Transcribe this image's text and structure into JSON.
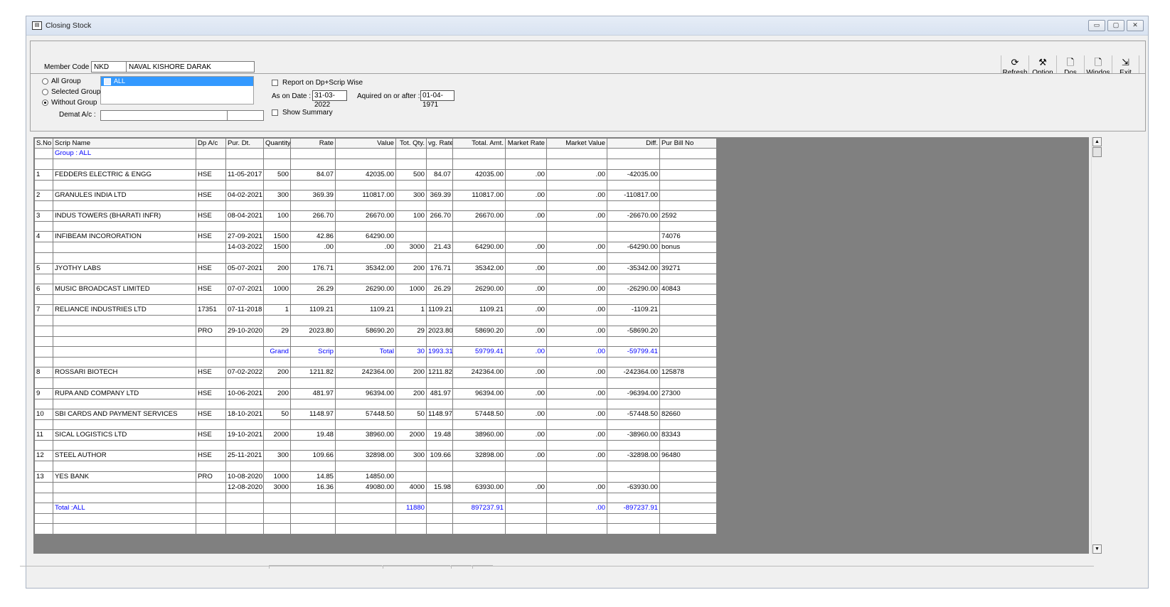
{
  "window": {
    "title": "Closing Stock",
    "icon": "app-icon",
    "buttons": {
      "minimize": "▭",
      "maximize": "▢",
      "close": "✕"
    }
  },
  "member": {
    "label": "Member Code :",
    "code": "NKD",
    "name": "NAVAL KISHORE DARAK"
  },
  "toolbar": [
    {
      "label": "Refresh",
      "icon": "refresh-icon",
      "glyph": "⟳"
    },
    {
      "label": "Option",
      "icon": "tools-icon",
      "glyph": "⚒"
    },
    {
      "label": "Dos",
      "icon": "dos-preview-icon",
      "glyph": "🗋"
    },
    {
      "label": "Windos",
      "icon": "window-preview-icon",
      "glyph": "🗋"
    },
    {
      "label": "Exit",
      "icon": "exit-door-icon",
      "glyph": "⇲"
    }
  ],
  "filters": {
    "radio_all": "All Group",
    "radio_selected": "Selected Group",
    "radio_without": "Without Group",
    "selected_radio": "without",
    "group_list_item": "ALL",
    "demat_label": "Demat A/c :",
    "report_dp_scrip": "Report on Dp+Scrip Wise",
    "as_on_label": "As on Date :",
    "as_on_value": "31-03-2022",
    "acquired_label": "Aquired on or after :",
    "acquired_value": "01-04-1971",
    "show_summary": "Show Summary"
  },
  "grid": {
    "columns": [
      "S.No",
      "Scrip Name",
      "Dp A/c",
      "Pur. Dt.",
      "Quantity",
      "Rate",
      "Value",
      "Tot. Qty.",
      "vg. Rate",
      "Total. Amt.",
      "Market Rate",
      "Market Value",
      "Diff.",
      "Pur Bill No"
    ],
    "rows": [
      {
        "c": [
          "",
          "Group : ALL",
          "",
          "",
          "",
          "",
          "",
          "",
          "",
          "",
          "",
          "",
          "",
          ""
        ],
        "blue": true
      },
      {
        "c": [
          "",
          "",
          "",
          "",
          "",
          "",
          "",
          "",
          "",
          "",
          "",
          "",
          "",
          ""
        ]
      },
      {
        "c": [
          "1",
          "FEDDERS ELECTRIC & ENGG",
          "HSE",
          "11-05-2017",
          "500",
          "84.07",
          "42035.00",
          "500",
          "84.07",
          "42035.00",
          ".00",
          ".00",
          "-42035.00",
          ""
        ]
      },
      {
        "c": [
          "",
          "",
          "",
          "",
          "",
          "",
          "",
          "",
          "",
          "",
          "",
          "",
          "",
          ""
        ]
      },
      {
        "c": [
          "2",
          "GRANULES INDIA LTD",
          "HSE",
          "04-02-2021",
          "300",
          "369.39",
          "110817.00",
          "300",
          "369.39",
          "110817.00",
          ".00",
          ".00",
          "-110817.00",
          ""
        ]
      },
      {
        "c": [
          "",
          "",
          "",
          "",
          "",
          "",
          "",
          "",
          "",
          "",
          "",
          "",
          "",
          ""
        ]
      },
      {
        "c": [
          "3",
          "INDUS TOWERS (BHARATI INFR)",
          "HSE",
          "08-04-2021",
          "100",
          "266.70",
          "26670.00",
          "100",
          "266.70",
          "26670.00",
          ".00",
          ".00",
          "-26670.00",
          "2592"
        ]
      },
      {
        "c": [
          "",
          "",
          "",
          "",
          "",
          "",
          "",
          "",
          "",
          "",
          "",
          "",
          "",
          ""
        ]
      },
      {
        "c": [
          "4",
          "INFIBEAM INCORORATION",
          "HSE",
          "27-09-2021",
          "1500",
          "42.86",
          "64290.00",
          "",
          "",
          "",
          "",
          "",
          "",
          "74076"
        ]
      },
      {
        "c": [
          "",
          "",
          "",
          "14-03-2022",
          "1500",
          ".00",
          ".00",
          "3000",
          "21.43",
          "64290.00",
          ".00",
          ".00",
          "-64290.00",
          "bonus"
        ]
      },
      {
        "c": [
          "",
          "",
          "",
          "",
          "",
          "",
          "",
          "",
          "",
          "",
          "",
          "",
          "",
          ""
        ]
      },
      {
        "c": [
          "5",
          "JYOTHY LABS",
          "HSE",
          "05-07-2021",
          "200",
          "176.71",
          "35342.00",
          "200",
          "176.71",
          "35342.00",
          ".00",
          ".00",
          "-35342.00",
          "39271"
        ]
      },
      {
        "c": [
          "",
          "",
          "",
          "",
          "",
          "",
          "",
          "",
          "",
          "",
          "",
          "",
          "",
          ""
        ]
      },
      {
        "c": [
          "6",
          "MUSIC BROADCAST LIMITED",
          "HSE",
          "07-07-2021",
          "1000",
          "26.29",
          "26290.00",
          "1000",
          "26.29",
          "26290.00",
          ".00",
          ".00",
          "-26290.00",
          "40843"
        ]
      },
      {
        "c": [
          "",
          "",
          "",
          "",
          "",
          "",
          "",
          "",
          "",
          "",
          "",
          "",
          "",
          ""
        ]
      },
      {
        "c": [
          "7",
          "RELIANCE INDUSTRIES LTD",
          "17351",
          "07-11-2018",
          "1",
          "1109.21",
          "1109.21",
          "1",
          "1109.21",
          "1109.21",
          ".00",
          ".00",
          "-1109.21",
          ""
        ]
      },
      {
        "c": [
          "",
          "",
          "",
          "",
          "",
          "",
          "",
          "",
          "",
          "",
          "",
          "",
          "",
          ""
        ]
      },
      {
        "c": [
          "",
          "",
          "PRO",
          "29-10-2020",
          "29",
          "2023.80",
          "58690.20",
          "29",
          "2023.80",
          "58690.20",
          ".00",
          ".00",
          "-58690.20",
          ""
        ]
      },
      {
        "c": [
          "",
          "",
          "",
          "",
          "",
          "",
          "",
          "",
          "",
          "",
          "",
          "",
          "",
          ""
        ]
      },
      {
        "c": [
          "",
          "",
          "",
          "",
          "Grand",
          "Scrip",
          "Total",
          "30",
          "1993.31",
          "59799.41",
          ".00",
          ".00",
          "-59799.41",
          ""
        ],
        "blue": true
      },
      {
        "c": [
          "",
          "",
          "",
          "",
          "",
          "",
          "",
          "",
          "",
          "",
          "",
          "",
          "",
          ""
        ]
      },
      {
        "c": [
          "8",
          "ROSSARI BIOTECH",
          "HSE",
          "07-02-2022",
          "200",
          "1211.82",
          "242364.00",
          "200",
          "1211.82",
          "242364.00",
          ".00",
          ".00",
          "-242364.00",
          "125878"
        ]
      },
      {
        "c": [
          "",
          "",
          "",
          "",
          "",
          "",
          "",
          "",
          "",
          "",
          "",
          "",
          "",
          ""
        ]
      },
      {
        "c": [
          "9",
          "RUPA AND COMPANY LTD",
          "HSE",
          "10-06-2021",
          "200",
          "481.97",
          "96394.00",
          "200",
          "481.97",
          "96394.00",
          ".00",
          ".00",
          "-96394.00",
          "27300"
        ]
      },
      {
        "c": [
          "",
          "",
          "",
          "",
          "",
          "",
          "",
          "",
          "",
          "",
          "",
          "",
          "",
          ""
        ]
      },
      {
        "c": [
          "10",
          "SBI CARDS AND PAYMENT SERVICES",
          "HSE",
          "18-10-2021",
          "50",
          "1148.97",
          "57448.50",
          "50",
          "1148.97",
          "57448.50",
          ".00",
          ".00",
          "-57448.50",
          "82660"
        ]
      },
      {
        "c": [
          "",
          "",
          "",
          "",
          "",
          "",
          "",
          "",
          "",
          "",
          "",
          "",
          "",
          ""
        ]
      },
      {
        "c": [
          "11",
          "SICAL LOGISTICS LTD",
          "HSE",
          "19-10-2021",
          "2000",
          "19.48",
          "38960.00",
          "2000",
          "19.48",
          "38960.00",
          ".00",
          ".00",
          "-38960.00",
          "83343"
        ]
      },
      {
        "c": [
          "",
          "",
          "",
          "",
          "",
          "",
          "",
          "",
          "",
          "",
          "",
          "",
          "",
          ""
        ]
      },
      {
        "c": [
          "12",
          "STEEL AUTHOR",
          "HSE",
          "25-11-2021",
          "300",
          "109.66",
          "32898.00",
          "300",
          "109.66",
          "32898.00",
          ".00",
          ".00",
          "-32898.00",
          "96480"
        ]
      },
      {
        "c": [
          "",
          "",
          "",
          "",
          "",
          "",
          "",
          "",
          "",
          "",
          "",
          "",
          "",
          ""
        ]
      },
      {
        "c": [
          "13",
          "YES BANK",
          "PRO",
          "10-08-2020",
          "1000",
          "14.85",
          "14850.00",
          "",
          "",
          "",
          "",
          "",
          "",
          ""
        ]
      },
      {
        "c": [
          "",
          "",
          "",
          "12-08-2020",
          "3000",
          "16.36",
          "49080.00",
          "4000",
          "15.98",
          "63930.00",
          ".00",
          ".00",
          "-63930.00",
          ""
        ]
      },
      {
        "c": [
          "",
          "",
          "",
          "",
          "",
          "",
          "",
          "",
          "",
          "",
          "",
          "",
          "",
          ""
        ]
      },
      {
        "c": [
          "",
          "Total :ALL",
          "",
          "",
          "",
          "",
          "",
          "11880",
          "",
          "897237.91",
          "",
          ".00",
          "-897237.91",
          ""
        ],
        "blue": true
      },
      {
        "c": [
          "",
          "",
          "",
          "",
          "",
          "",
          "",
          "",
          "",
          "",
          "",
          "",
          "",
          ""
        ]
      },
      {
        "c": [
          "",
          "",
          "",
          "",
          "",
          "",
          "",
          "",
          "",
          "",
          "",
          "",
          "",
          ""
        ]
      }
    ]
  },
  "scrollbar": {
    "up": "▲",
    "down": "▼"
  }
}
